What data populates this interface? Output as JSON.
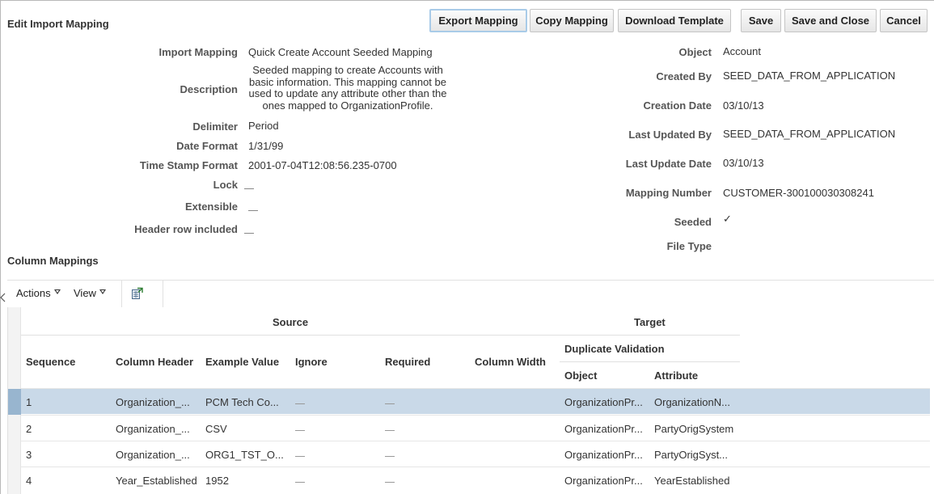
{
  "header": {
    "title": "Edit Import Mapping",
    "buttons": {
      "export": "Export Mapping",
      "copy": "Copy Mapping",
      "download": "Download Template",
      "save": "Save",
      "save_close": "Save and Close",
      "cancel": "Cancel"
    }
  },
  "details_left": {
    "import_mapping_label": "Import Mapping",
    "import_mapping_value": "Quick Create Account Seeded Mapping",
    "description_label": "Description",
    "description_value": "Seeded mapping to create Accounts with basic information. This mapping cannot be used to update any attribute other than the ones mapped to OrganizationProfile.",
    "delimiter_label": "Delimiter",
    "delimiter_value": "Period",
    "date_format_label": "Date Format",
    "date_format_value": "1/31/99",
    "timestamp_format_label": "Time Stamp Format",
    "timestamp_format_value": "2001-07-04T12:08:56.235-0700",
    "lock_label": "Lock",
    "extensible_label": "Extensible",
    "header_row_label": "Header row included"
  },
  "details_right": {
    "object_label": "Object",
    "object_value": "Account",
    "created_by_label": "Created By",
    "created_by_value": "SEED_DATA_FROM_APPLICATION",
    "creation_date_label": "Creation Date",
    "creation_date_value": "03/10/13",
    "last_updated_by_label": "Last Updated By",
    "last_updated_by_value": "SEED_DATA_FROM_APPLICATION",
    "last_update_date_label": "Last Update Date",
    "last_update_date_value": "03/10/13",
    "mapping_number_label": "Mapping Number",
    "mapping_number_value": "CUSTOMER-300100030308241",
    "seeded_label": "Seeded",
    "seeded_value": "✓",
    "file_type_label": "File Type"
  },
  "column_mappings": {
    "title": "Column Mappings",
    "toolbar": {
      "actions": "Actions",
      "view": "View"
    },
    "headers": {
      "source": "Source",
      "target": "Target",
      "duplicate_validation": "Duplicate Validation",
      "sequence": "Sequence",
      "column_header": "Column Header",
      "example_value": "Example Value",
      "ignore": "Ignore",
      "required": "Required",
      "column_width": "Column Width",
      "object": "Object",
      "attribute": "Attribute"
    },
    "rows": [
      {
        "sequence": "1",
        "column_header": "Organization_...",
        "example_value": "PCM Tech Co...",
        "object": "OrganizationPr...",
        "attribute": "OrganizationN...",
        "selected": true
      },
      {
        "sequence": "2",
        "column_header": "Organization_...",
        "example_value": "CSV",
        "object": "OrganizationPr...",
        "attribute": "PartyOrigSystem",
        "selected": false
      },
      {
        "sequence": "3",
        "column_header": "Organization_...",
        "example_value": "ORG1_TST_O...",
        "object": "OrganizationPr...",
        "attribute": "PartyOrigSyst...",
        "selected": false
      },
      {
        "sequence": "4",
        "column_header": "Year_Established",
        "example_value": "1952",
        "object": "OrganizationPr...",
        "attribute": "YearEstablished",
        "selected": false
      }
    ]
  }
}
